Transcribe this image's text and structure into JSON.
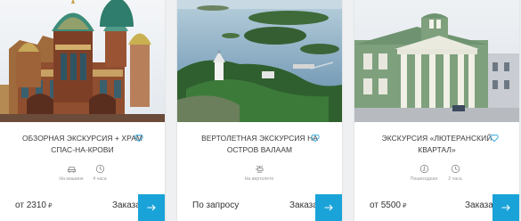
{
  "cards": [
    {
      "title": "ОБЗОРНАЯ ЭКСКУРСИЯ + ХРАМ СПАС-НА-КРОВИ",
      "features": [
        {
          "icon": "car-icon",
          "label": "На машине"
        },
        {
          "icon": "clock-icon",
          "label": "4 часа"
        }
      ],
      "price": "от 2310",
      "currency": "₽",
      "order_label": "Заказать"
    },
    {
      "title": "ВЕРТОЛЕТНАЯ ЭКСКУРСИЯ НА ОСТРОВ ВАЛААМ",
      "features": [
        {
          "icon": "helicopter-icon",
          "label": "На вертолете"
        }
      ],
      "price": "По запросу",
      "order_label": "Заказать"
    },
    {
      "title": "ЭКСКУРСИЯ «ЛЮТЕРАНСКИЙ КВАРТАЛ»",
      "features": [
        {
          "icon": "walking-icon",
          "label": "Пешеходная"
        },
        {
          "icon": "clock-icon",
          "label": "2 часа"
        }
      ],
      "price": "от 5500",
      "currency": "₽",
      "order_label": "Заказать"
    }
  ],
  "colors": {
    "accent": "#1aa3d9",
    "heart": "#2aa6dc",
    "muted_text": "#9a9a9a",
    "background": "#eef0f2"
  }
}
